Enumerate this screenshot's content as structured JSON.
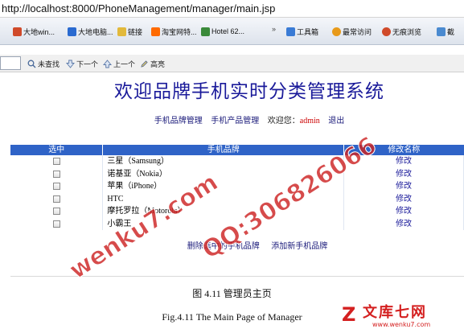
{
  "browser": {
    "url": "http://localhost:8000/PhoneManagement/manager/main.jsp",
    "favorites": [
      {
        "label": "大地win...",
        "icon": "page-icon",
        "color": "#d04a2a"
      },
      {
        "label": "大地电脑...",
        "icon": "page-icon",
        "color": "#2a6ad0"
      },
      {
        "label": "链接",
        "icon": "folder-icon",
        "color": "#e2b93b"
      },
      {
        "label": "淘宝网特...",
        "icon": "taobao-icon",
        "color": "#ff6a00"
      },
      {
        "label": "Hotel 62...",
        "icon": "page-icon",
        "color": "#3a8a3a"
      }
    ],
    "overflow_label": "»",
    "tools": [
      {
        "label": "工具箱",
        "icon": "toolbox-icon",
        "color": "#3a7bd5"
      },
      {
        "label": "最常访问",
        "icon": "star-icon",
        "color": "#e89a1a"
      },
      {
        "label": "无痕浏览",
        "icon": "privacy-icon",
        "color": "#d04a2a"
      },
      {
        "label": "截",
        "icon": "screenshot-icon",
        "color": "#4a8ad0"
      }
    ],
    "find_bar": {
      "input_value": "",
      "not_found": "未查找",
      "next": "下一个",
      "prev": "上一个",
      "highlight": "高亮"
    }
  },
  "page": {
    "title": "欢迎品牌手机实时分类管理系统",
    "nav": {
      "brand_mgmt": "手机品牌管理",
      "product_mgmt": "手机产品管理",
      "welcome": "欢迎您：",
      "user": "admin",
      "logout": "退出"
    },
    "table": {
      "headers": [
        "选中",
        "手机品牌",
        "修改名称"
      ],
      "rows": [
        {
          "brand": "三星（Samsung）",
          "edit": "修改"
        },
        {
          "brand": "诺基亚（Nokia）",
          "edit": "修改"
        },
        {
          "brand": "苹果（iPhone）",
          "edit": "修改"
        },
        {
          "brand": "HTC",
          "edit": "修改"
        },
        {
          "brand": "摩托罗拉（Motorola）",
          "edit": "修改"
        },
        {
          "brand": "小霸王",
          "edit": "修改"
        }
      ]
    },
    "actions": {
      "delete_selected": "删除选中的手机品牌",
      "add_brand": "添加新手机品牌"
    }
  },
  "document": {
    "caption_cn": "图 4.11   管理员主页",
    "caption_en": "Fig.4.11    The Main Page of Manager"
  },
  "watermark": {
    "text_1": "wenku7.com",
    "text_2": "QQ:306826066",
    "logo_mark": "Z",
    "logo_cn": "文库七网",
    "logo_url": "www.wenku7.com"
  }
}
